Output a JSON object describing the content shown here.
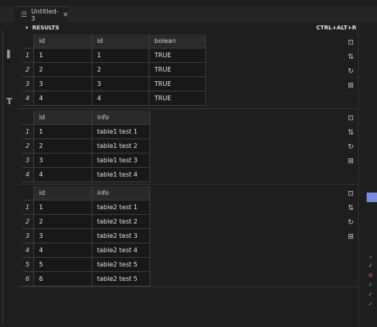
{
  "editor": {
    "tab_title": "Untitled-3",
    "tab_icon": "file-icon",
    "close_glyph": "×"
  },
  "results": {
    "label": "RESULTS",
    "shortcut": "CTRL+ALT+R"
  },
  "grid1": {
    "columns": [
      "id",
      "id",
      "bolean"
    ],
    "rows": [
      [
        "1",
        "1",
        "1",
        "TRUE"
      ],
      [
        "2",
        "2",
        "2",
        "TRUE"
      ],
      [
        "3",
        "3",
        "3",
        "TRUE"
      ],
      [
        "4",
        "4",
        "4",
        "TRUE"
      ]
    ]
  },
  "grid2": {
    "columns": [
      "id",
      "info"
    ],
    "rows": [
      [
        "1",
        "1",
        "table1 test 1"
      ],
      [
        "2",
        "2",
        "table1 test 2"
      ],
      [
        "3",
        "3",
        "table1 test 3"
      ],
      [
        "4",
        "4",
        "table1 test 4"
      ]
    ]
  },
  "grid3": {
    "columns": [
      "id",
      "info"
    ],
    "rows": [
      [
        "1",
        "1",
        "table2 test 1"
      ],
      [
        "2",
        "2",
        "table2 test 2"
      ],
      [
        "3",
        "3",
        "table2 test 3"
      ],
      [
        "4",
        "4",
        "table2 test 4"
      ],
      [
        "5",
        "5",
        "table2 test 5"
      ],
      [
        "6",
        "6",
        "table2 test 5"
      ]
    ]
  },
  "icons": {
    "save_as_csv": "export-csv-icon",
    "save_as_json": "export-json-icon",
    "refresh": "refresh-icon",
    "save_as_excel": "export-excel-icon"
  },
  "colors": {
    "scroll_thumb": "#7a8be0",
    "background": "#1e1e1e"
  }
}
